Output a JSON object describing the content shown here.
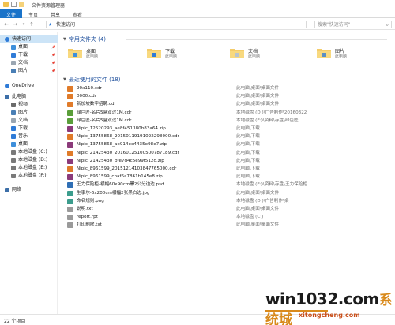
{
  "window": {
    "title": "文件资源管理器"
  },
  "ribbon": {
    "tabs": [
      "文件",
      "主页",
      "共享",
      "查看"
    ]
  },
  "address": {
    "path": "快速访问",
    "search_placeholder": "搜索\"快速访问\""
  },
  "sidebar": {
    "items": [
      {
        "label": "快速访问",
        "icon": "star-icon",
        "pinned": false
      },
      {
        "label": "桌面",
        "icon": "desktop-folder-icon",
        "pinned": true
      },
      {
        "label": "下载",
        "icon": "download-icon",
        "pinned": true
      },
      {
        "label": "文档",
        "icon": "documents-icon",
        "pinned": true
      },
      {
        "label": "图片",
        "icon": "pictures-icon",
        "pinned": true
      },
      {
        "label": "OneDrive",
        "icon": "cloud-icon",
        "pinned": false
      },
      {
        "label": "此电脑",
        "icon": "computer-icon",
        "pinned": false
      },
      {
        "label": "视频",
        "icon": "video-icon",
        "pinned": false
      },
      {
        "label": "图片",
        "icon": "pictures-icon",
        "pinned": false
      },
      {
        "label": "文档",
        "icon": "documents-icon",
        "pinned": false
      },
      {
        "label": "下载",
        "icon": "download-icon",
        "pinned": false
      },
      {
        "label": "音乐",
        "icon": "music-icon",
        "pinned": false
      },
      {
        "label": "桌面",
        "icon": "desktop-folder-icon",
        "pinned": false
      },
      {
        "label": "本地磁盘 (C:)",
        "icon": "drive-icon",
        "pinned": false
      },
      {
        "label": "本地磁盘 (D:)",
        "icon": "drive-icon",
        "pinned": false
      },
      {
        "label": "本地磁盘 (E:)",
        "icon": "drive-icon",
        "pinned": false
      },
      {
        "label": "本地磁盘 (F:)",
        "icon": "drive-icon",
        "pinned": false
      },
      {
        "label": "网络",
        "icon": "network-icon",
        "pinned": false
      }
    ]
  },
  "frequent": {
    "header": "常用文件夹 (4)",
    "folders": [
      {
        "name": "桌面",
        "location": "此电脑"
      },
      {
        "name": "下载",
        "location": "此电脑"
      },
      {
        "name": "文档",
        "location": "此电脑"
      },
      {
        "name": "图片",
        "location": "此电脑"
      }
    ]
  },
  "recent": {
    "header": "最近使用的文件 (18)",
    "files": [
      {
        "name": "90x110.cdr",
        "location": "此电脑\\桌面\\桌面文件",
        "color": "#e07b2a"
      },
      {
        "name": "0000.cdr",
        "location": "此电脑\\桌面\\桌面文件",
        "color": "#e07b2a"
      },
      {
        "name": "新加坡数字招聘.cdr",
        "location": "此电脑\\桌面\\桌面文件",
        "color": "#e07b2a"
      },
      {
        "name": "绿巨匠-名片5盒双过1M.cdr",
        "location": "本地磁盘 (D:)\\广告制作\\20160322",
        "color": "#5a9e3a"
      },
      {
        "name": "绿巨匠-名片5盒双过1M.cdr",
        "location": "本地磁盘 (E:)\\资料\\存盘\\绿巨匠",
        "color": "#5a9e3a"
      },
      {
        "name": "Nipic_12520293_ae8f451380b83a64.zip",
        "location": "此电脑\\下载",
        "color": "#8b3a7a"
      },
      {
        "name": "Nipic_13755868_20150119191022298000.cdr",
        "location": "此电脑\\下载",
        "color": "#e07b2a"
      },
      {
        "name": "Nipic_13755868_ae914ee4435e98e7.zip",
        "location": "此电脑\\下载",
        "color": "#8b3a7a"
      },
      {
        "name": "Nipic_21425430_20160125100500787189.cdr",
        "location": "此电脑\\下载",
        "color": "#e07b2a"
      },
      {
        "name": "Nipic_21425430_bfe7d4c5e99f512d.zip",
        "location": "此电脑\\下载",
        "color": "#8b3a7a"
      },
      {
        "name": "Nipic_8961599_20151214103847765000.cdr",
        "location": "此电脑\\下载",
        "color": "#e07b2a"
      },
      {
        "name": "Nipic_8961599_cbaf6a7861b145e8.zip",
        "location": "此电脑\\下载",
        "color": "#8b3a7a"
      },
      {
        "name": "王力保险柜-横幅60x90cm黑2公分边边.psd",
        "location": "本地磁盘 (E:)\\资料\\存盘\\王力保险柜",
        "color": "#2f6fb5"
      },
      {
        "name": "生事尔-6x200cm横幅2张黑白边.jpg",
        "location": "此电脑\\桌面\\桌面文件",
        "color": "#3c9d8d"
      },
      {
        "name": "命名规则.png",
        "location": "本地磁盘 (D:)\\广告制作\\桌",
        "color": "#3c9d8d"
      },
      {
        "name": "说明.txt",
        "location": "此电脑\\桌面\\桌面文件",
        "color": "#9a9a9a"
      },
      {
        "name": "report.rpt",
        "location": "本地磁盘 (C:)",
        "color": "#9a9a9a"
      },
      {
        "name": "打印删除.txt",
        "location": "此电脑\\桌面\\桌面文件",
        "color": "#9a9a9a"
      }
    ]
  },
  "status": {
    "count": "22 个项目"
  },
  "watermark": {
    "brand": "win1032.com",
    "cn": "系统城",
    "url": "xitongcheng.com"
  }
}
